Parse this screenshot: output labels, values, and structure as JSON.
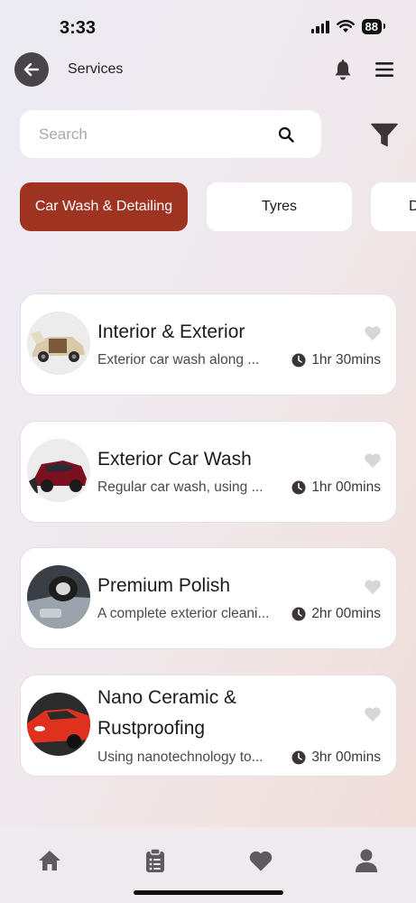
{
  "status_bar": {
    "time": "3:33",
    "battery": "88"
  },
  "header": {
    "title": "Services"
  },
  "search": {
    "placeholder": "Search",
    "value": ""
  },
  "categories": [
    {
      "label": "Car Wash & Detailing",
      "active": true
    },
    {
      "label": "Tyres",
      "active": false
    },
    {
      "label": "D",
      "active": false
    }
  ],
  "services": [
    {
      "title": "Interior & Exterior",
      "description": "Exterior car wash along ...",
      "duration": "1hr 30mins",
      "image": "car-interior-photo"
    },
    {
      "title": "Exterior Car Wash",
      "description": "Regular car wash, using ...",
      "duration": "1hr 00mins",
      "image": "car-wash-photo"
    },
    {
      "title": "Premium Polish",
      "description": "A complete exterior cleani...",
      "duration": "2hr 00mins",
      "image": "polish-photo"
    },
    {
      "title": "Nano Ceramic & Rustproofing",
      "description": "Using nanotechnology to...",
      "duration": "3hr 00mins",
      "image": "red-car-photo"
    }
  ],
  "bottom_nav": [
    {
      "icon": "home-icon"
    },
    {
      "icon": "clipboard-icon"
    },
    {
      "icon": "heart-icon"
    },
    {
      "icon": "user-icon"
    }
  ],
  "colors": {
    "accent": "#9f3321",
    "icon_dark": "#3b3538",
    "heart_inactive": "#d8d6d8",
    "nav_icon": "#5f5a5e"
  }
}
